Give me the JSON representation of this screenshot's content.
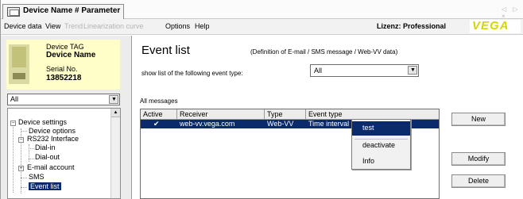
{
  "window": {
    "tab_title": "Device Name # Parameter",
    "nav_arrows": "◁ ▷ ×"
  },
  "menubar": {
    "items": [
      {
        "label": "Device data",
        "enabled": true
      },
      {
        "label": "View",
        "enabled": true
      },
      {
        "label": "Trend",
        "enabled": false
      },
      {
        "label": "Linearization curve",
        "enabled": false
      },
      {
        "label": "Options",
        "enabled": true
      },
      {
        "label": "Help",
        "enabled": true
      }
    ],
    "license": "Lizenz: Professional",
    "logo": "VEGA"
  },
  "device": {
    "tag_label": "Device TAG",
    "name": "Device Name",
    "serial_label": "Serial No.",
    "serial_value": "13852218"
  },
  "left_filter": {
    "value": "All"
  },
  "tree": {
    "root": "Device settings",
    "items": [
      "Device options",
      "RS232 Interface",
      "Dial-in",
      "Dial-out",
      "E-mail account",
      "SMS",
      "Event list"
    ],
    "selected": "Event list"
  },
  "main": {
    "title": "Event list",
    "definition": "(Definition of E-mail / SMS message / Web-VV data)",
    "show_label": "show list of the following event type:",
    "type_select_value": "All",
    "all_messages_label": "All messages",
    "columns": [
      "Active",
      "Receiver",
      "Type",
      "Event type"
    ],
    "rows": [
      {
        "active": "✔",
        "receiver": "web-vv.vega.com",
        "type": "Web-VV",
        "event_type": "Time interval"
      }
    ]
  },
  "context_menu": {
    "items": [
      "test",
      "deactivate",
      "Info"
    ],
    "highlighted": "test"
  },
  "buttons": {
    "new": "New",
    "modify": "Modify",
    "delete": "Delete"
  },
  "colors": {
    "selection": "#0a2a6c",
    "device_panel": "#fffdc8",
    "logo": "#d6d600"
  }
}
